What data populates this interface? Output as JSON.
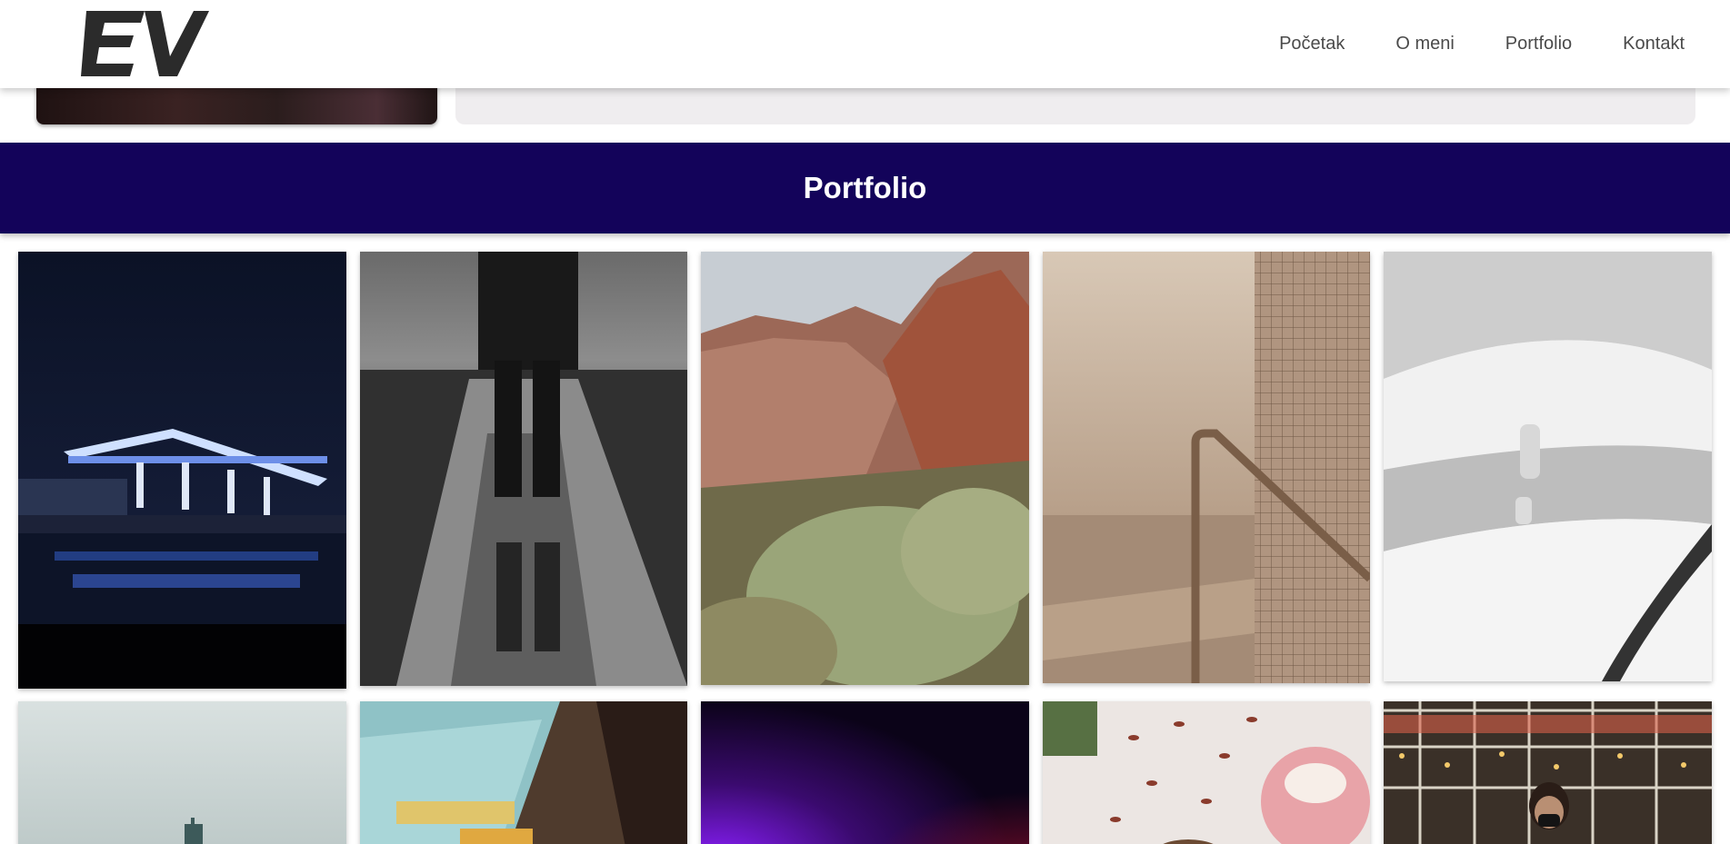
{
  "header": {
    "logo_text": "EV",
    "nav": [
      {
        "label": "Početak"
      },
      {
        "label": "O meni"
      },
      {
        "label": "Portfolio"
      },
      {
        "label": "Kontakt"
      }
    ]
  },
  "portfolio": {
    "title": "Portfolio"
  },
  "colors": {
    "banner": "#13035a",
    "nav_text": "#4a4a4a",
    "logo": "#2b2b2b"
  }
}
